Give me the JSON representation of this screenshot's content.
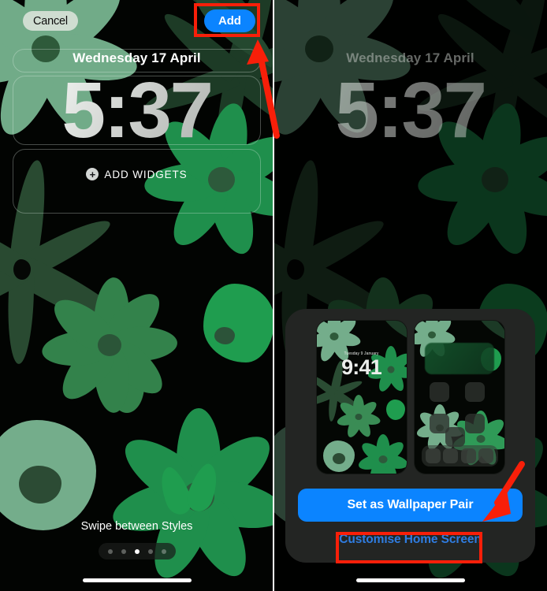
{
  "screen": {
    "title": "iOS Lock Screen wallpaper setup",
    "accent_blue": "#0b84ff",
    "link_blue": "#2f7ce0",
    "annotation_red": "#f81f09",
    "wallpaper_theme": "green-flowers-on-black"
  },
  "left_panel": {
    "name": "lock-screen-editor",
    "topbar": {
      "cancel_label": "Cancel",
      "add_label": "Add"
    },
    "lock_screen": {
      "date": "Wednesday 17 April",
      "time": "5:37",
      "add_widgets_label": "ADD WIDGETS",
      "add_widgets_icon": "plus-circle-icon"
    },
    "footer": {
      "swipe_hint": "Swipe between Styles",
      "page_dots_total": 5,
      "page_dots_active_index": 2
    },
    "home_indicator": "home-indicator"
  },
  "right_panel": {
    "name": "wallpaper-pair-sheet",
    "background_lock_screen": {
      "date": "Wednesday 17 April",
      "time": "5:37"
    },
    "sheet": {
      "lock_preview": {
        "date": "Tuesday 9 January",
        "time": "9:41"
      },
      "home_preview": {
        "widget_count": 1,
        "icon_count": 2,
        "dock_slots": 4
      },
      "set_pair_label": "Set as Wallpaper Pair",
      "customise_label": "Customise Home Screen"
    },
    "home_indicator": "home-indicator"
  },
  "annotations": {
    "boxes": [
      {
        "target": "Add",
        "color": "#f81f09"
      },
      {
        "target": "Customise Home Screen",
        "color": "#f81f09"
      }
    ],
    "arrows": [
      {
        "points_to": "Add",
        "color": "#f81f09"
      },
      {
        "points_to": "Set as Wallpaper Pair",
        "color": "#f81f09"
      }
    ]
  }
}
